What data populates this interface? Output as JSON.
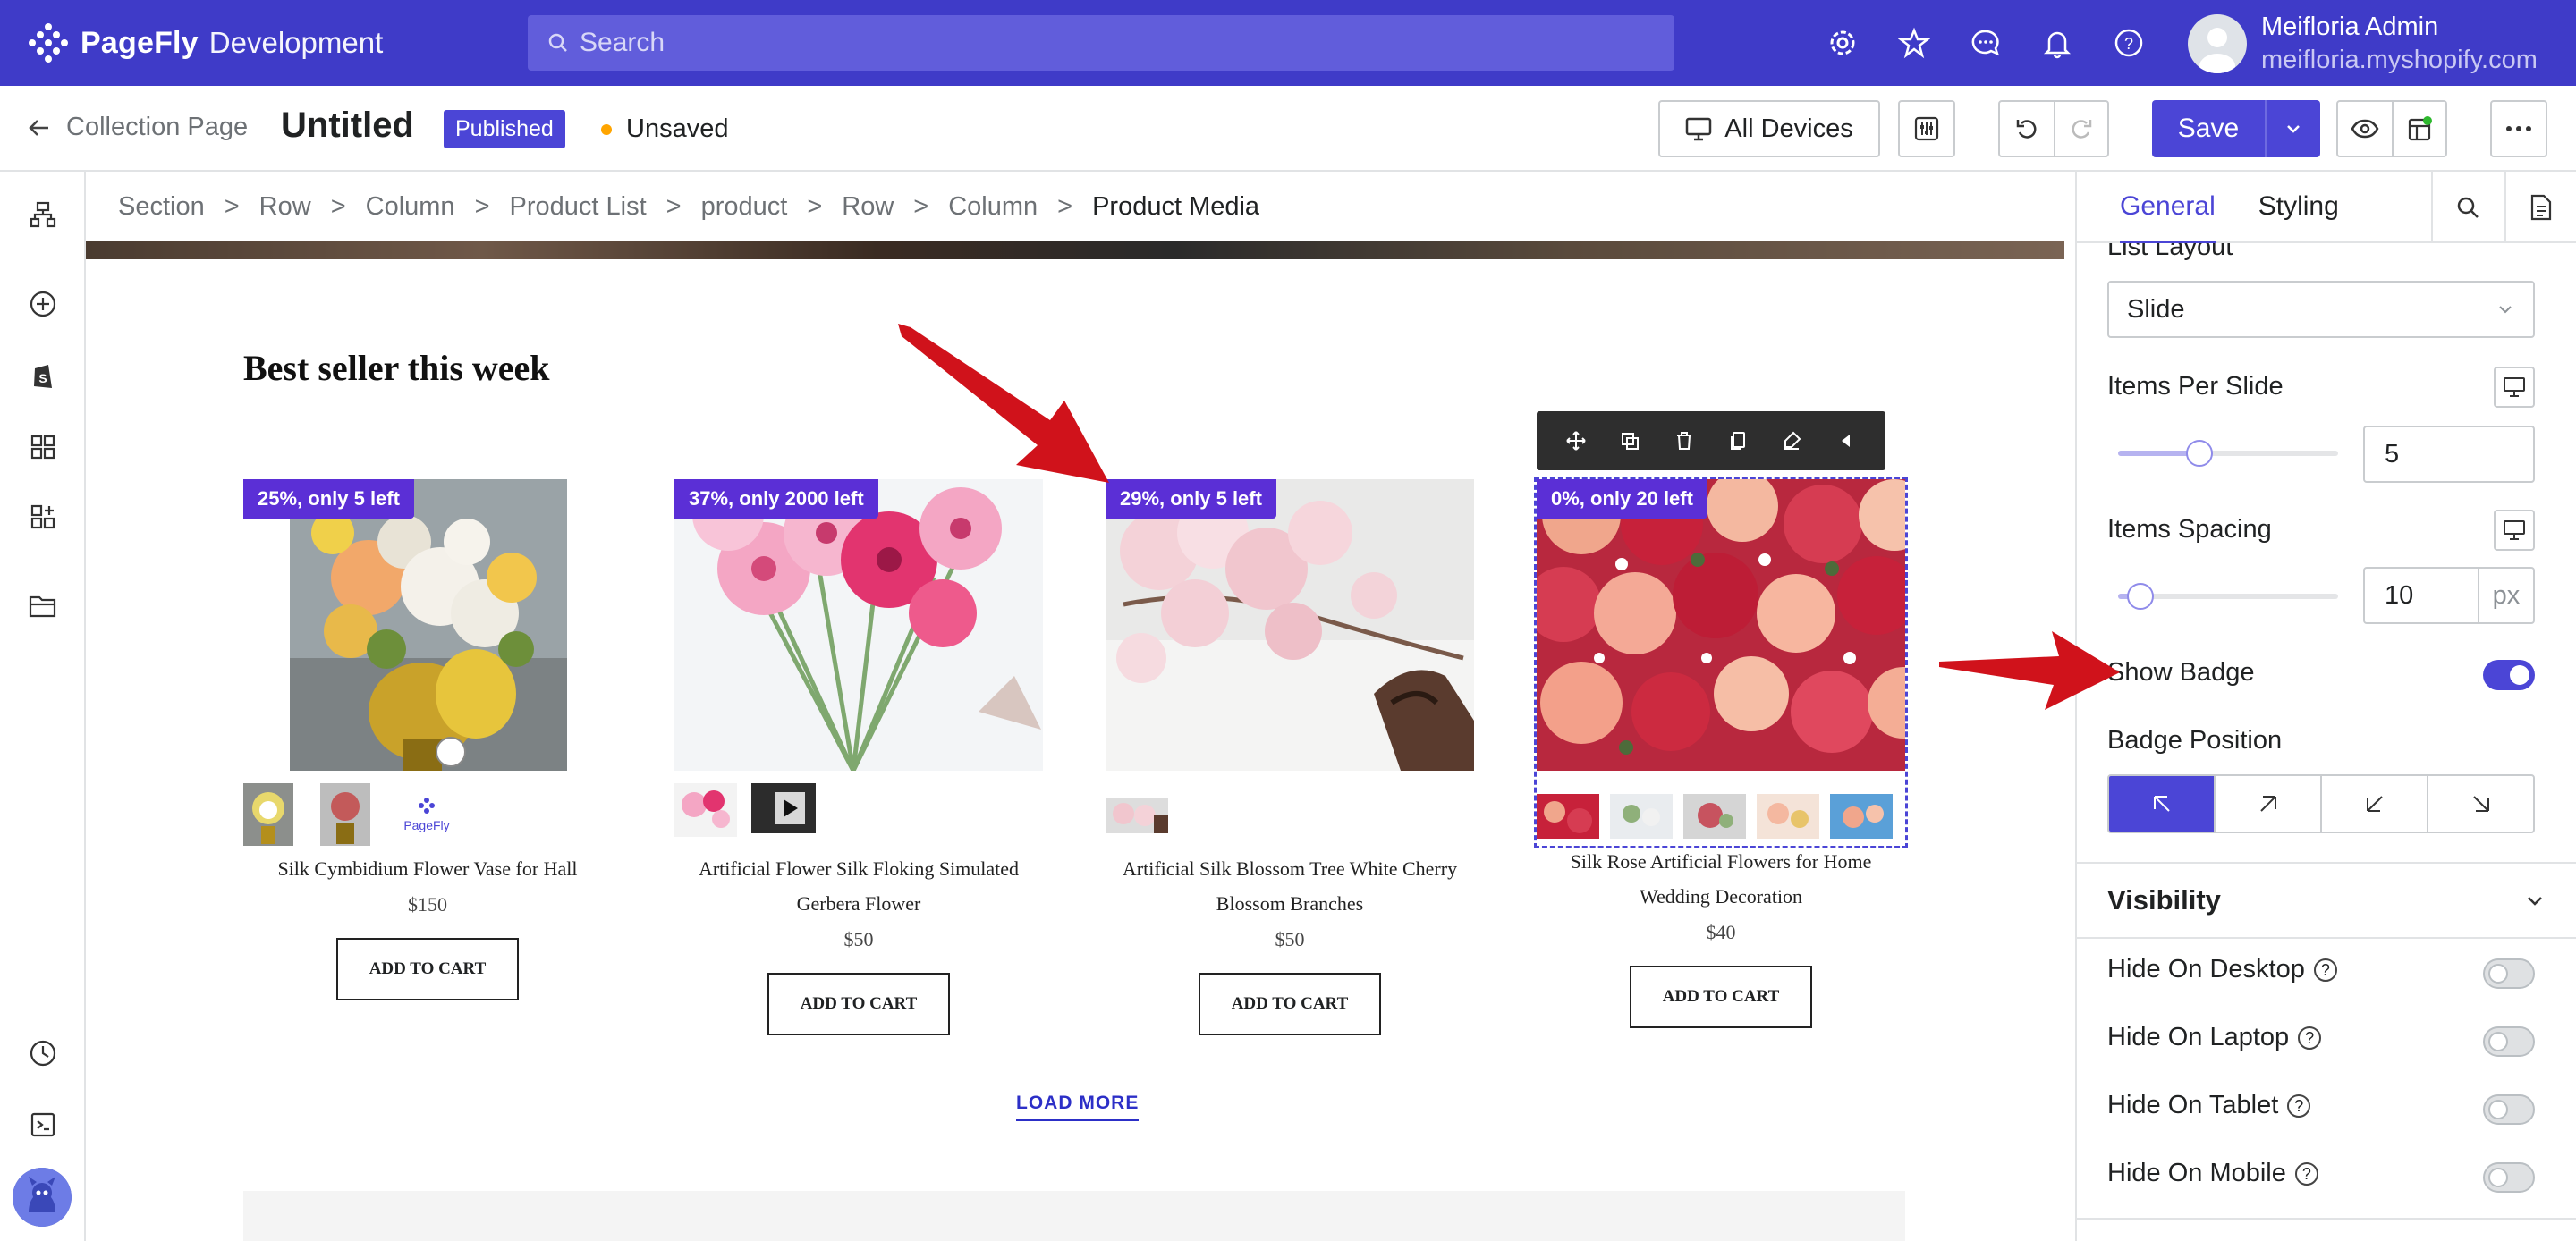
{
  "app": {
    "brand": "PageFly",
    "env": "Development"
  },
  "search": {
    "placeholder": "Search"
  },
  "user": {
    "name": "Meifloria Admin",
    "store": "meifloria.myshopify.com"
  },
  "toolbar": {
    "back_label": "Collection Page",
    "page_title": "Untitled",
    "status_badge": "Published",
    "save_state": "Unsaved",
    "devices_label": "All Devices",
    "save_label": "Save"
  },
  "breadcrumb": [
    "Section",
    "Row",
    "Column",
    "Product List",
    "product",
    "Row",
    "Column",
    "Product Media"
  ],
  "canvas": {
    "section_title": "Best seller this week",
    "load_more": "LOAD MORE",
    "thumb_brand": "PageFly",
    "products": [
      {
        "badge": "25%, only 5 left",
        "name": "Silk Cymbidium Flower Vase for Hall",
        "price": "$150",
        "cta": "ADD TO CART"
      },
      {
        "badge": "37%, only 2000 left",
        "name": "Artificial Flower Silk Floking Simulated Gerbera Flower",
        "price": "$50",
        "cta": "ADD TO CART"
      },
      {
        "badge": "29%, only 5 left",
        "name": "Artificial Silk Blossom Tree White Cherry Blossom Branches",
        "price": "$50",
        "cta": "ADD TO CART"
      },
      {
        "badge": "0%, only 20 left",
        "name": "Silk Rose Artificial Flowers for Home Wedding Decoration",
        "price": "$40",
        "cta": "ADD TO CART"
      }
    ]
  },
  "panel": {
    "tabs": [
      "General",
      "Styling"
    ],
    "list_layout_label": "List Layout",
    "list_layout_value": "Slide",
    "items_per_slide_label": "Items Per Slide",
    "items_per_slide_value": "5",
    "items_spacing_label": "Items Spacing",
    "items_spacing_value": "10",
    "items_spacing_unit": "px",
    "show_badge_label": "Show Badge",
    "show_badge_on": true,
    "badge_position_label": "Badge Position",
    "visibility_title": "Visibility",
    "visibility_items": [
      {
        "label": "Hide On Desktop",
        "on": false
      },
      {
        "label": "Hide On Laptop",
        "on": false
      },
      {
        "label": "Hide On Tablet",
        "on": false
      },
      {
        "label": "Hide On Mobile",
        "on": false
      }
    ]
  },
  "colors": {
    "accent": "#4b45d6",
    "topbar": "#3f3bc8",
    "badge": "#5b2fd6",
    "annotation_arrow": "#d0121b"
  }
}
